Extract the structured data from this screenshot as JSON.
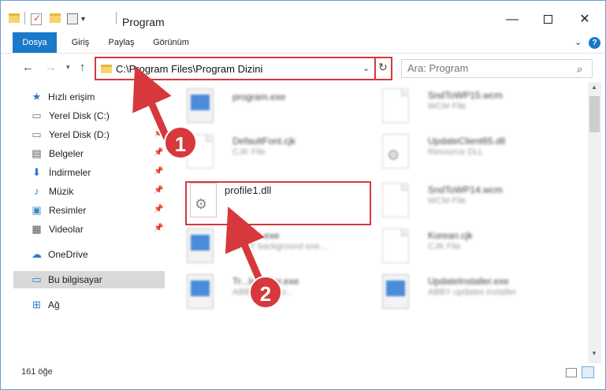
{
  "window": {
    "title": "Program",
    "minimize": "—",
    "close": "✕"
  },
  "ribbon": {
    "tabs": [
      "Dosya",
      "Giriş",
      "Paylaş",
      "Görünüm"
    ],
    "help": "?"
  },
  "nav": {
    "back": "←",
    "forward": "→",
    "up": "↑",
    "address": "C:\\Program Files\\Program Dizini",
    "search_placeholder": "Ara: Program"
  },
  "sidebar": {
    "items": [
      {
        "label": "Hızlı erişim",
        "icon": "star-icon",
        "pinned": false
      },
      {
        "label": "Yerel Disk (C:)",
        "icon": "drive-icon",
        "pinned": false
      },
      {
        "label": "Yerel Disk (D:)",
        "icon": "drive-icon",
        "pinned": true
      },
      {
        "label": "Belgeler",
        "icon": "documents-icon",
        "pinned": true
      },
      {
        "label": "İndirmeler",
        "icon": "downloads-icon",
        "pinned": true
      },
      {
        "label": "Müzik",
        "icon": "music-icon",
        "pinned": true
      },
      {
        "label": "Resimler",
        "icon": "pictures-icon",
        "pinned": true
      },
      {
        "label": "Videolar",
        "icon": "videos-icon",
        "pinned": true
      },
      {
        "label": "OneDrive",
        "icon": "cloud-icon",
        "pinned": false
      },
      {
        "label": "Bu bilgisayar",
        "icon": "computer-icon",
        "pinned": false
      },
      {
        "label": "Ağ",
        "icon": "network-icon",
        "pinned": false
      }
    ]
  },
  "files": [
    {
      "name": "program.exe",
      "type": "",
      "icon": "installer-icon"
    },
    {
      "name": "SndToWP15.wcm",
      "type": "WCM File",
      "icon": "document-icon"
    },
    {
      "name": "DefaultFont.cjk",
      "type": "CJK File",
      "icon": "document-icon"
    },
    {
      "name": "UpdateClient65.dll",
      "type": "Resource DLL",
      "icon": "gear-document-icon"
    },
    {
      "name": "profile1.dll",
      "type": "",
      "icon": "gear-document-icon"
    },
    {
      "name": "SndToWP14.wcm",
      "type": "WCM File",
      "icon": "document-icon"
    },
    {
      "name": "...Exec.exe",
      "type": "ABBY background exe...",
      "icon": "application-icon"
    },
    {
      "name": "Korean.cjk",
      "type": "CJK File",
      "icon": "document-icon"
    },
    {
      "name": "Tr...Installer.exe",
      "type": "ABB...aster to...",
      "icon": "application-icon"
    },
    {
      "name": "UpdateInstaller.exe",
      "type": "ABBY updates installer",
      "icon": "application-icon"
    }
  ],
  "status": {
    "count": "161 öğe"
  },
  "annotations": {
    "step1": "1",
    "step2": "2"
  },
  "colors": {
    "accent": "#1979ca",
    "highlight": "#d6383c"
  }
}
